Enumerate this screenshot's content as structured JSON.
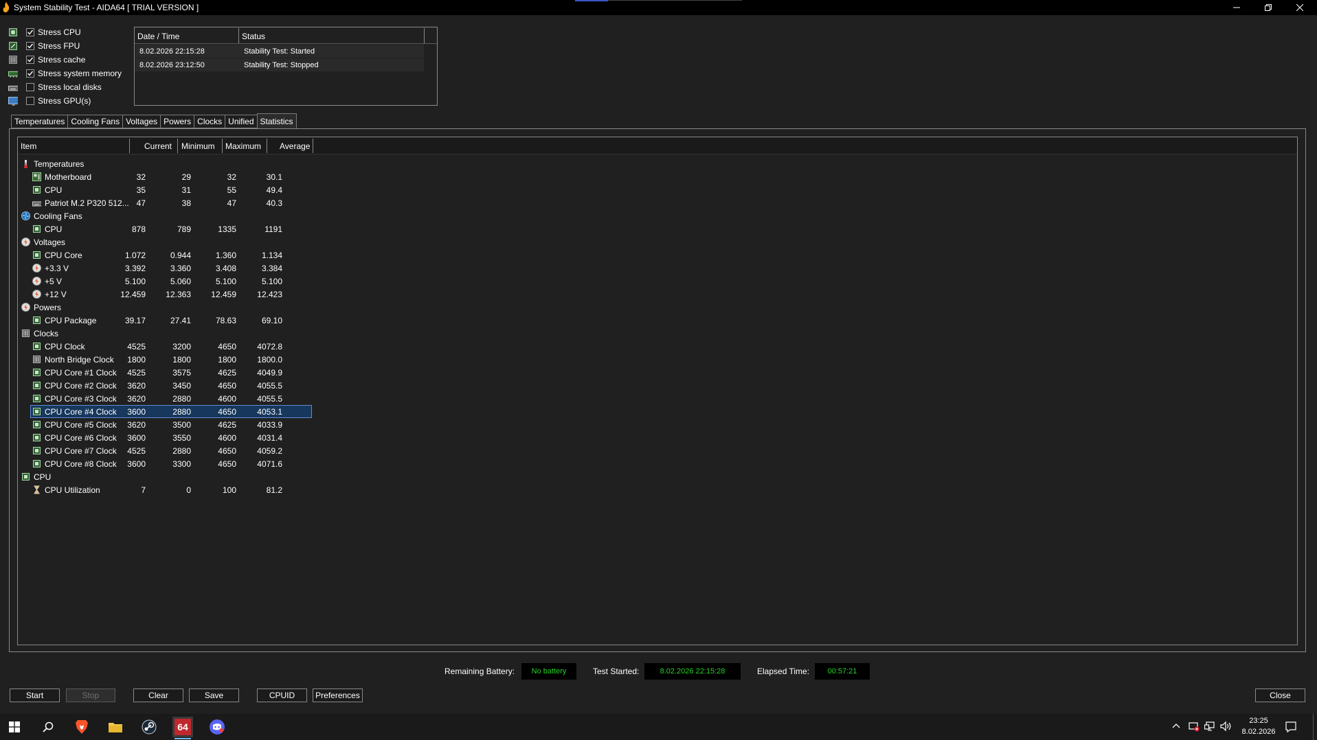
{
  "window": {
    "title": "System Stability Test - AIDA64  [ TRIAL VERSION ]",
    "minimize_label": "─",
    "restore_label": "❐",
    "close_label": "✕"
  },
  "stress_options": [
    {
      "label": "Stress CPU",
      "checked": true,
      "icon": "cpu-chip-icon"
    },
    {
      "label": "Stress FPU",
      "checked": true,
      "icon": "fpu-chip-icon"
    },
    {
      "label": "Stress cache",
      "checked": true,
      "icon": "cache-icon"
    },
    {
      "label": "Stress system memory",
      "checked": true,
      "icon": "memory-module-icon"
    },
    {
      "label": "Stress local disks",
      "checked": false,
      "icon": "disk-drive-icon"
    },
    {
      "label": "Stress GPU(s)",
      "checked": false,
      "icon": "monitor-icon"
    }
  ],
  "log": {
    "headers": [
      "Date / Time",
      "Status"
    ],
    "rows": [
      {
        "datetime": "8.02.2026 22:15:28",
        "status": "Stability Test: Started"
      },
      {
        "datetime": "8.02.2026 23:12:50",
        "status": "Stability Test: Stopped"
      }
    ]
  },
  "tabs": [
    "Temperatures",
    "Cooling Fans",
    "Voltages",
    "Powers",
    "Clocks",
    "Unified",
    "Statistics"
  ],
  "active_tab": "Statistics",
  "stats": {
    "headers": [
      "Item",
      "Current",
      "Minimum",
      "Maximum",
      "Average"
    ],
    "rows": [
      {
        "level": 0,
        "icon": "thermometer-icon",
        "name": "Temperatures"
      },
      {
        "level": 1,
        "icon": "motherboard-icon",
        "name": "Motherboard",
        "current": "32",
        "minimum": "29",
        "maximum": "32",
        "average": "30.1"
      },
      {
        "level": 1,
        "icon": "cpu-chip-icon",
        "name": "CPU",
        "current": "35",
        "minimum": "31",
        "maximum": "55",
        "average": "49.4"
      },
      {
        "level": 1,
        "icon": "disk-drive-icon",
        "name": "Patriot M.2 P320 512...",
        "current": "47",
        "minimum": "38",
        "maximum": "47",
        "average": "40.3"
      },
      {
        "level": 0,
        "icon": "fan-icon",
        "name": "Cooling Fans"
      },
      {
        "level": 1,
        "icon": "cpu-chip-icon",
        "name": "CPU",
        "current": "878",
        "minimum": "789",
        "maximum": "1335",
        "average": "1191"
      },
      {
        "level": 0,
        "icon": "voltage-icon",
        "name": "Voltages"
      },
      {
        "level": 1,
        "icon": "cpu-chip-icon",
        "name": "CPU Core",
        "current": "1.072",
        "minimum": "0.944",
        "maximum": "1.360",
        "average": "1.134"
      },
      {
        "level": 1,
        "icon": "voltage-icon",
        "name": "+3.3 V",
        "current": "3.392",
        "minimum": "3.360",
        "maximum": "3.408",
        "average": "3.384"
      },
      {
        "level": 1,
        "icon": "voltage-icon",
        "name": "+5 V",
        "current": "5.100",
        "minimum": "5.060",
        "maximum": "5.100",
        "average": "5.100"
      },
      {
        "level": 1,
        "icon": "voltage-icon",
        "name": "+12 V",
        "current": "12.459",
        "minimum": "12.363",
        "maximum": "12.459",
        "average": "12.423"
      },
      {
        "level": 0,
        "icon": "power-icon",
        "name": "Powers"
      },
      {
        "level": 1,
        "icon": "cpu-chip-icon",
        "name": "CPU Package",
        "current": "39.17",
        "minimum": "27.41",
        "maximum": "78.63",
        "average": "69.10"
      },
      {
        "level": 0,
        "icon": "clock-chip-icon",
        "name": "Clocks"
      },
      {
        "level": 1,
        "icon": "cpu-chip-icon",
        "name": "CPU Clock",
        "current": "4525",
        "minimum": "3200",
        "maximum": "4650",
        "average": "4072.8"
      },
      {
        "level": 1,
        "icon": "northbridge-icon",
        "name": "North Bridge Clock",
        "current": "1800",
        "minimum": "1800",
        "maximum": "1800",
        "average": "1800.0"
      },
      {
        "level": 1,
        "icon": "cpu-chip-icon",
        "name": "CPU Core #1 Clock",
        "current": "4525",
        "minimum": "3575",
        "maximum": "4625",
        "average": "4049.9"
      },
      {
        "level": 1,
        "icon": "cpu-chip-icon",
        "name": "CPU Core #2 Clock",
        "current": "3620",
        "minimum": "3450",
        "maximum": "4650",
        "average": "4055.5"
      },
      {
        "level": 1,
        "icon": "cpu-chip-icon",
        "name": "CPU Core #3 Clock",
        "current": "3620",
        "minimum": "2880",
        "maximum": "4600",
        "average": "4055.5"
      },
      {
        "level": 1,
        "icon": "cpu-chip-icon",
        "name": "CPU Core #4 Clock",
        "current": "3600",
        "minimum": "2880",
        "maximum": "4650",
        "average": "4053.1",
        "selected": true
      },
      {
        "level": 1,
        "icon": "cpu-chip-icon",
        "name": "CPU Core #5 Clock",
        "current": "3620",
        "minimum": "3500",
        "maximum": "4625",
        "average": "4033.9"
      },
      {
        "level": 1,
        "icon": "cpu-chip-icon",
        "name": "CPU Core #6 Clock",
        "current": "3600",
        "minimum": "3550",
        "maximum": "4600",
        "average": "4031.4"
      },
      {
        "level": 1,
        "icon": "cpu-chip-icon",
        "name": "CPU Core #7 Clock",
        "current": "4525",
        "minimum": "2880",
        "maximum": "4650",
        "average": "4059.2"
      },
      {
        "level": 1,
        "icon": "cpu-chip-icon",
        "name": "CPU Core #8 Clock",
        "current": "3600",
        "minimum": "3300",
        "maximum": "4650",
        "average": "4071.6"
      },
      {
        "level": 0,
        "icon": "cpu-chip-icon",
        "name": "CPU"
      },
      {
        "level": 1,
        "icon": "hourglass-icon",
        "name": "CPU Utilization",
        "current": "7",
        "minimum": "0",
        "maximum": "100",
        "average": "81.2"
      }
    ]
  },
  "status": {
    "battery_label": "Remaining Battery:",
    "battery_value": "No battery",
    "started_label": "Test Started:",
    "started_value": "8.02.2026 22:15:28",
    "elapsed_label": "Elapsed Time:",
    "elapsed_value": "00:57:21"
  },
  "buttons": {
    "start": "Start",
    "stop": "Stop",
    "clear": "Clear",
    "save": "Save",
    "cpuid": "CPUID",
    "preferences": "Preferences",
    "close": "Close"
  },
  "taskbar": {
    "aida_label": "64",
    "time": "23:25",
    "date": "8.02.2026"
  },
  "colors": {
    "status_green": "#27d327",
    "selection": "#17375c"
  }
}
